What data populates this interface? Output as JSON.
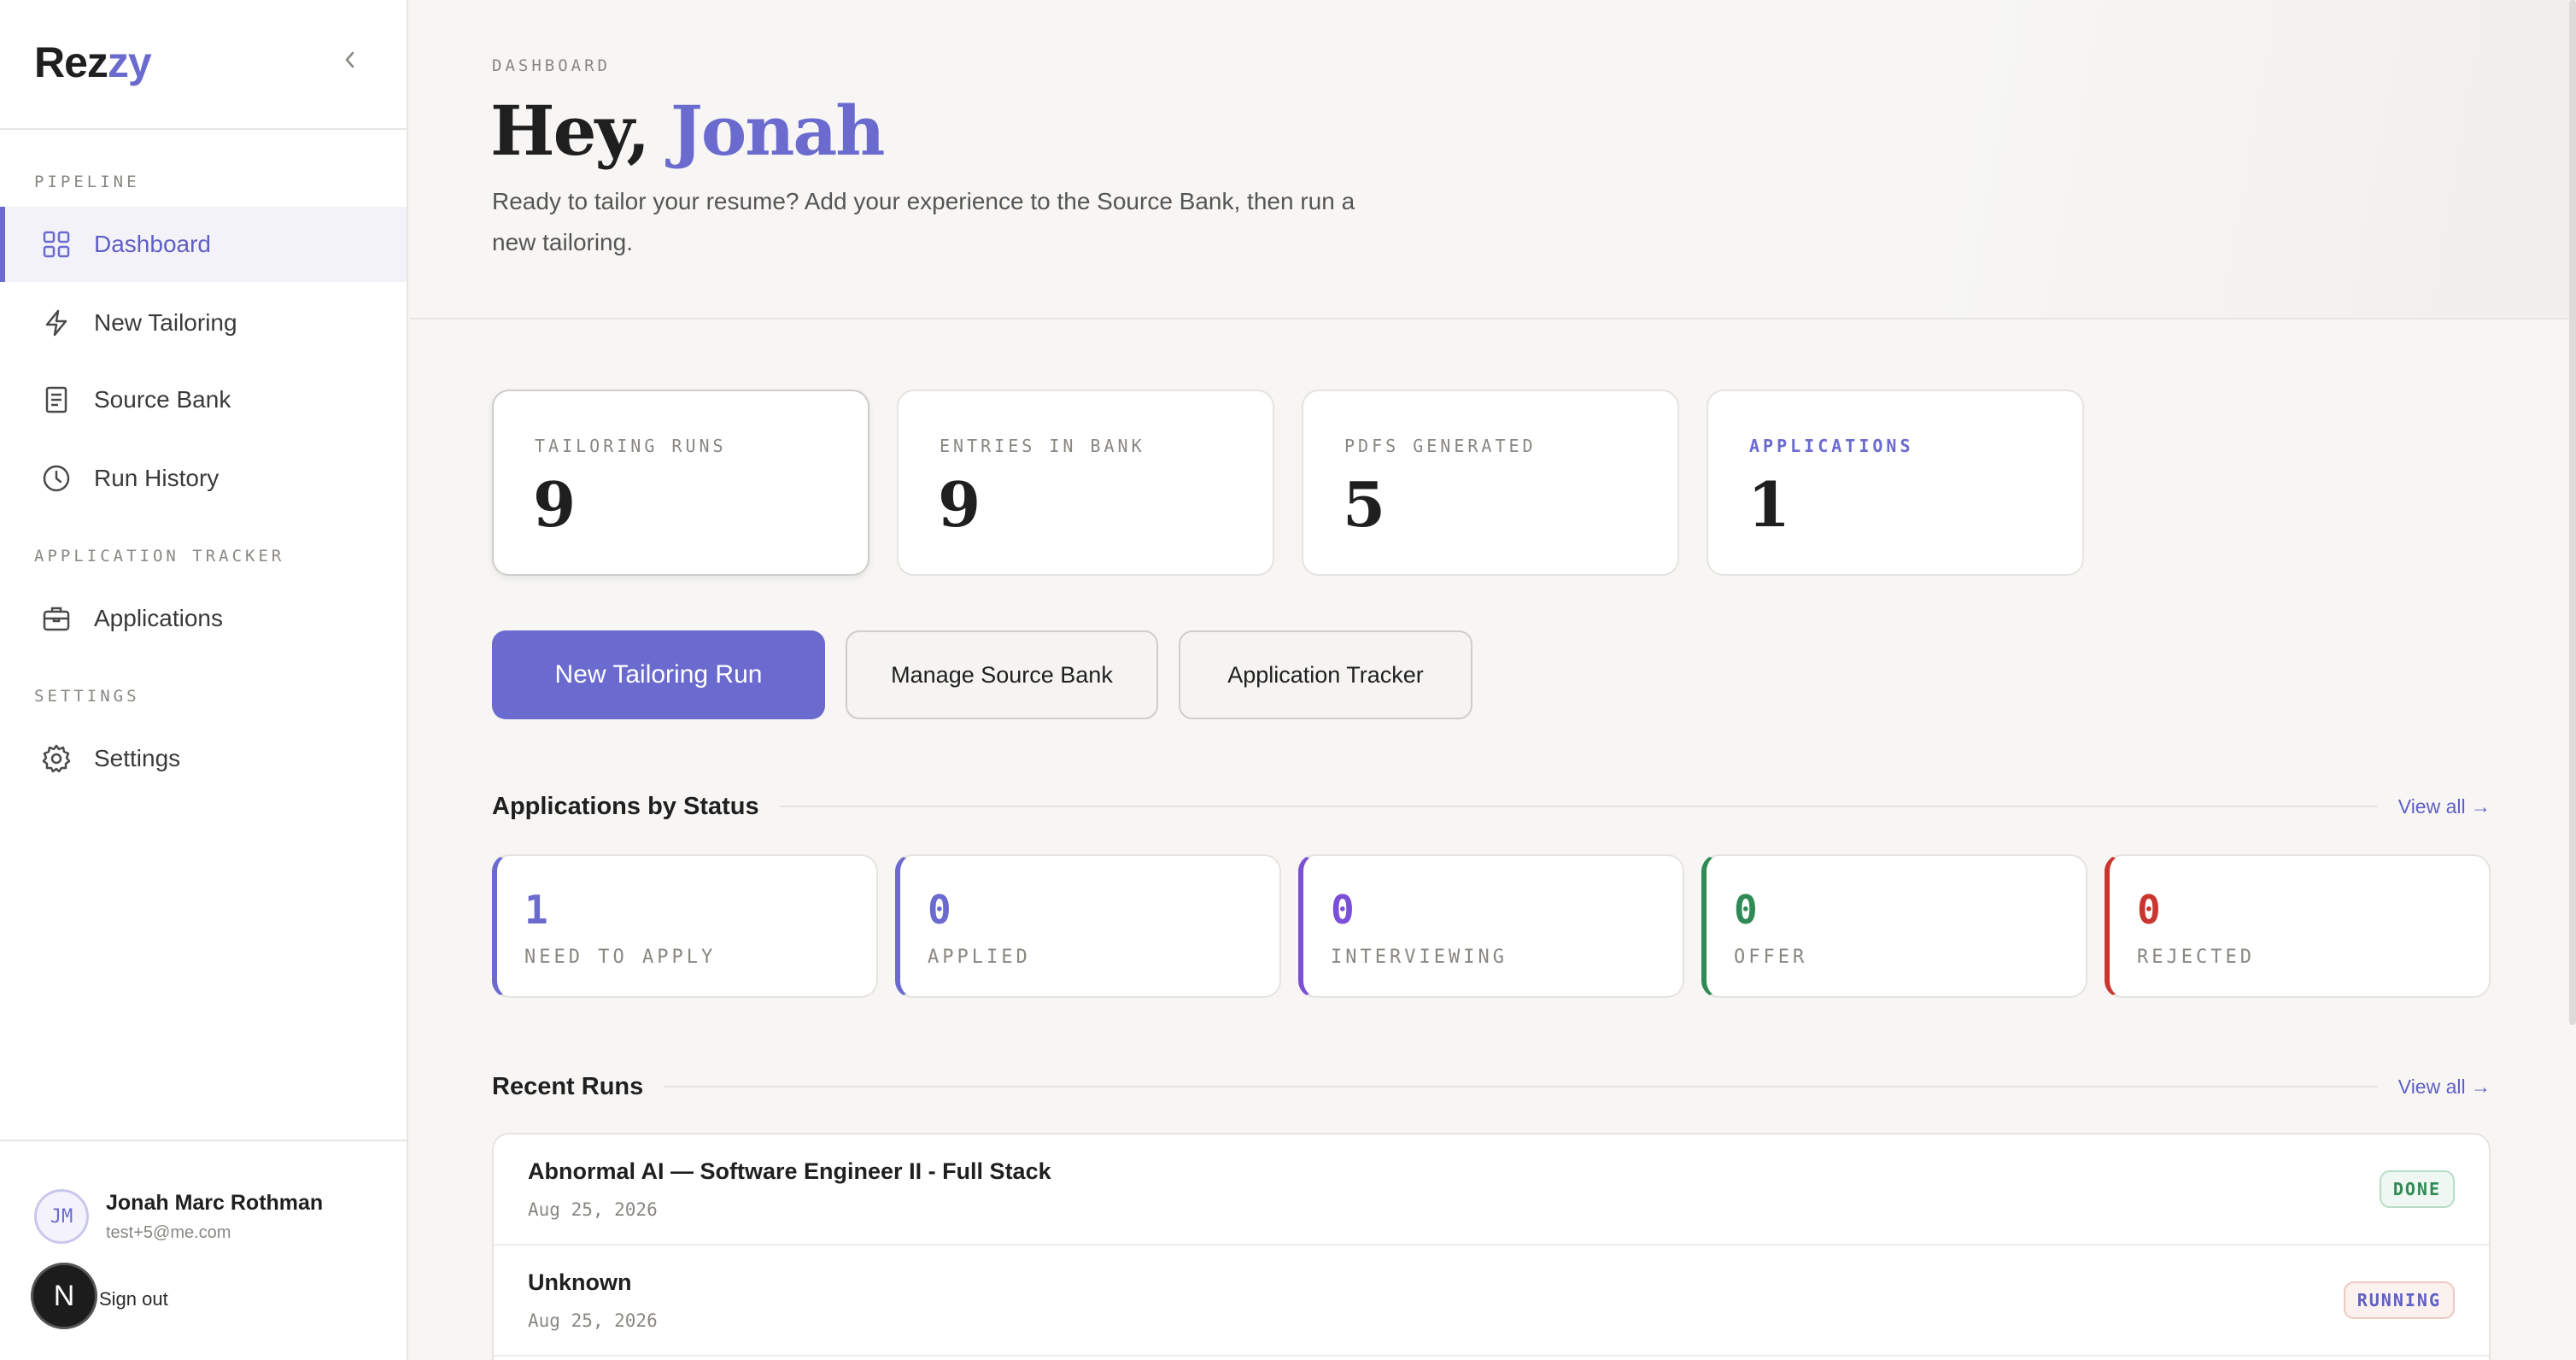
{
  "brand": {
    "prefix": "Rez",
    "accent": "zy"
  },
  "sidebar": {
    "sections": [
      {
        "label": "PIPELINE"
      },
      {
        "label": "APPLICATION TRACKER"
      },
      {
        "label": "SETTINGS"
      }
    ],
    "items": [
      {
        "label": "Dashboard",
        "icon": "grid-icon",
        "active": true
      },
      {
        "label": "New Tailoring",
        "icon": "lightning-icon"
      },
      {
        "label": "Source Bank",
        "icon": "document-icon"
      },
      {
        "label": "Run History",
        "icon": "clock-icon"
      },
      {
        "label": "Applications",
        "icon": "briefcase-icon"
      },
      {
        "label": "Settings",
        "icon": "gear-icon"
      }
    ],
    "user": {
      "initials": "JM",
      "name": "Jonah Marc Rothman",
      "email": "test+5@me.com",
      "badge": "N",
      "signout": "Sign out"
    }
  },
  "header": {
    "eyebrow": "DASHBOARD",
    "greeting_prefix": "Hey, ",
    "greeting_name": "Jonah",
    "subtitle": "Ready to tailor your resume? Add your experience to the Source Bank, then run a new tailoring."
  },
  "stats": [
    {
      "label": "TAILORING RUNS",
      "value": "9"
    },
    {
      "label": "ENTRIES IN BANK",
      "value": "9"
    },
    {
      "label": "PDFS GENERATED",
      "value": "5"
    },
    {
      "label": "APPLICATIONS",
      "value": "1"
    }
  ],
  "actions": {
    "primary": "New Tailoring Run",
    "manage": "Manage Source Bank",
    "tracker": "Application Tracker"
  },
  "applications_by_status": {
    "title": "Applications by Status",
    "view_all": "View all →",
    "statuses": [
      {
        "count": "1",
        "label": "NEED TO APPLY",
        "color": "#6b6bcf"
      },
      {
        "count": "0",
        "label": "APPLIED",
        "color": "#6b6bcf"
      },
      {
        "count": "0",
        "label": "INTERVIEWING",
        "color": "#7b4fd6"
      },
      {
        "count": "0",
        "label": "OFFER",
        "color": "#2f8a55"
      },
      {
        "count": "0",
        "label": "REJECTED",
        "color": "#c9352f"
      }
    ]
  },
  "recent_runs": {
    "title": "Recent Runs",
    "view_all": "View all →",
    "runs": [
      {
        "title": "Abnormal AI — Software Engineer II - Full Stack",
        "date": "Aug 25, 2026",
        "status": "DONE"
      },
      {
        "title": "Unknown",
        "date": "Aug 25, 2026",
        "status": "RUNNING"
      }
    ]
  }
}
